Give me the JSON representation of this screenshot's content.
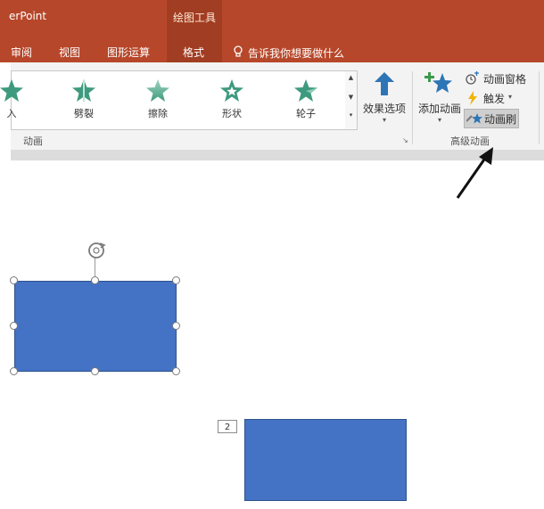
{
  "titlebar": {
    "app_title": "erPoint",
    "context_group": "绘图工具"
  },
  "tabs": [
    {
      "label": "审阅"
    },
    {
      "label": "视图"
    },
    {
      "label": "图形运算"
    },
    {
      "label": "格式"
    }
  ],
  "tell_me": "告诉我你想要做什么",
  "animations": {
    "effects": [
      {
        "label": "入",
        "icon": "star-fly-in-icon"
      },
      {
        "label": "劈裂",
        "icon": "star-split-icon"
      },
      {
        "label": "擦除",
        "icon": "star-wipe-icon"
      },
      {
        "label": "形状",
        "icon": "star-shape-icon"
      },
      {
        "label": "轮子",
        "icon": "star-wheel-icon"
      }
    ],
    "effect_options": "效果选项",
    "group_label": "动画"
  },
  "advanced": {
    "add_animation": "添加动画",
    "animation_pane": "动画窗格",
    "trigger": "触发",
    "animation_painter": "动画刷",
    "group_label": "高级动画"
  },
  "slide": {
    "animation_tag": "2"
  },
  "colors": {
    "ribbon_accent": "#b7472a",
    "shape_fill": "#4472c4",
    "star_green": "#3e9a7e"
  }
}
